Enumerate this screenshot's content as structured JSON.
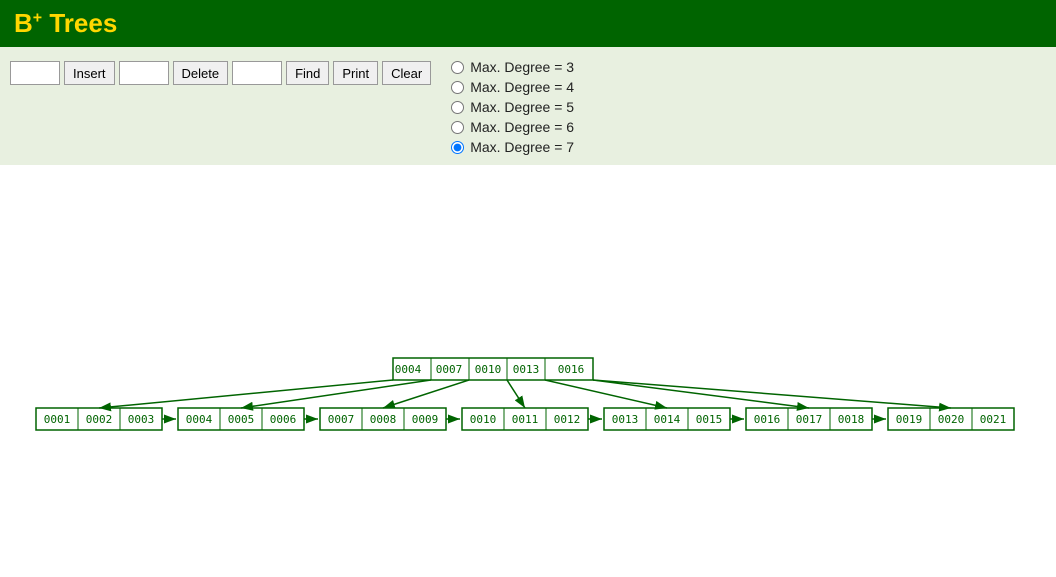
{
  "header": {
    "title": "B",
    "superscript": "+",
    "title_suffix": " Trees"
  },
  "toolbar": {
    "insert_label": "Insert",
    "delete_label": "Delete",
    "find_label": "Find",
    "print_label": "Print",
    "clear_label": "Clear",
    "insert_placeholder": "",
    "delete_placeholder": "",
    "find_placeholder": ""
  },
  "radio_options": [
    {
      "label": "Max. Degree = 3",
      "value": "3",
      "checked": false
    },
    {
      "label": "Max. Degree = 4",
      "value": "4",
      "checked": false
    },
    {
      "label": "Max. Degree = 5",
      "value": "5",
      "checked": false
    },
    {
      "label": "Max. Degree = 6",
      "value": "6",
      "checked": false
    },
    {
      "label": "Max. Degree = 7",
      "value": "7",
      "checked": true
    }
  ],
  "tree": {
    "root_node": [
      "0004",
      "0007",
      "0010",
      "0013",
      "0016"
    ],
    "leaf_nodes": [
      [
        "0001",
        "0002",
        "0003"
      ],
      [
        "0004",
        "0005",
        "0006"
      ],
      [
        "0007",
        "0008",
        "0009"
      ],
      [
        "0010",
        "0011",
        "0012"
      ],
      [
        "0013",
        "0014",
        "0015"
      ],
      [
        "0016",
        "0017",
        "0018"
      ],
      [
        "0019",
        "0020",
        "0021"
      ]
    ]
  }
}
